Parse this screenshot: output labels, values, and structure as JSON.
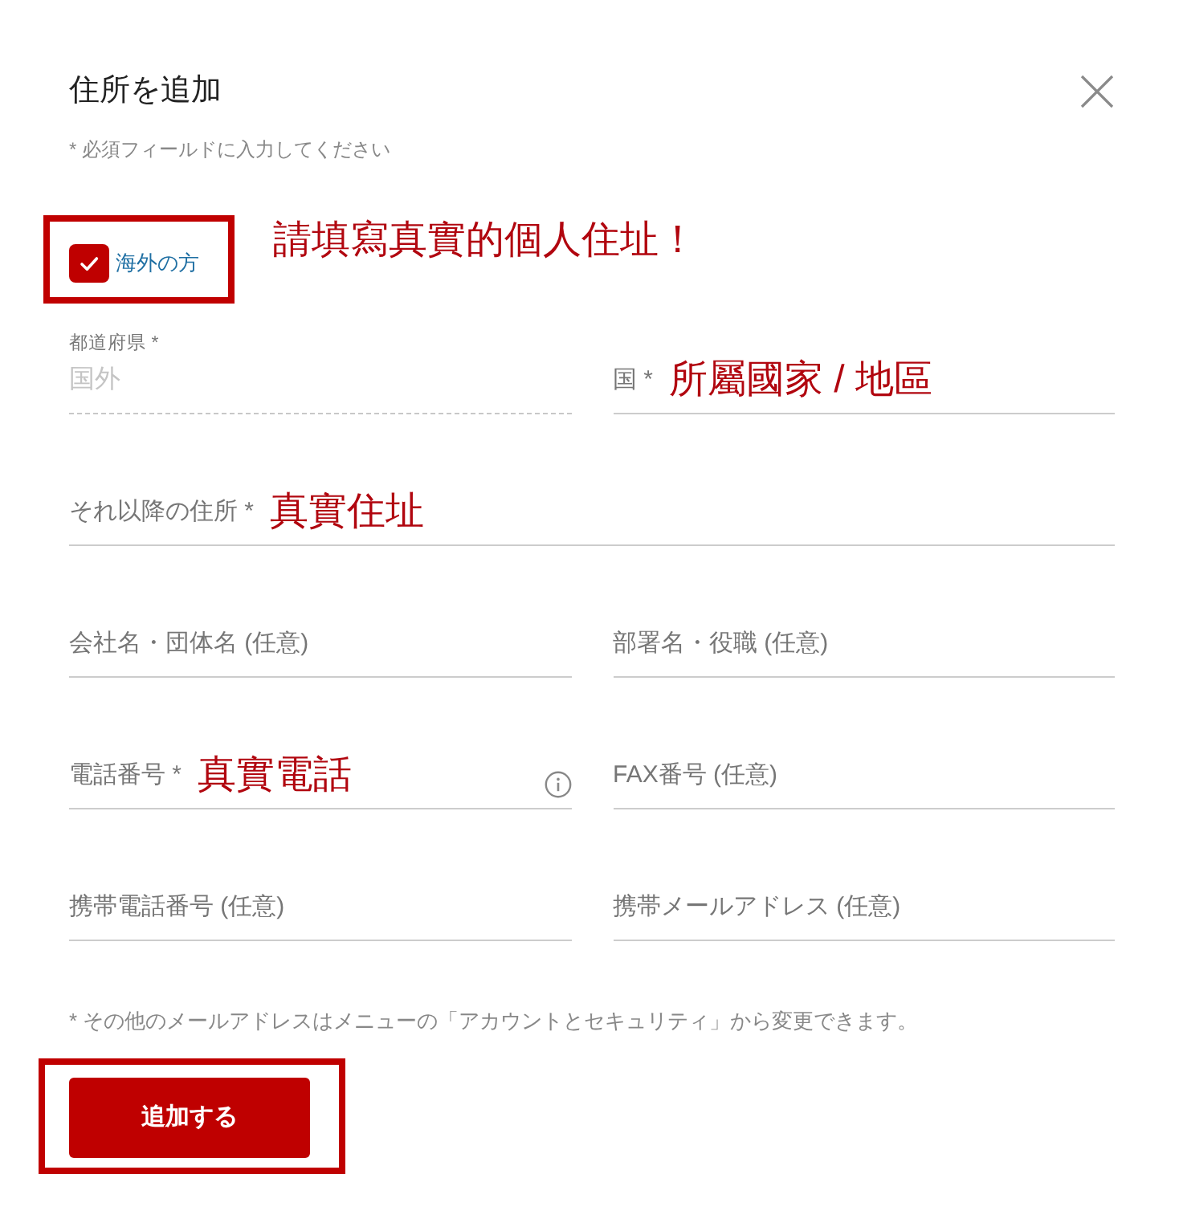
{
  "dialog": {
    "title": "住所を追加",
    "required_note": "* 必須フィールドに入力してください"
  },
  "overseas": {
    "label": "海外の方",
    "checked": true,
    "highlighted": true,
    "annotation": "請填寫真實的個人住址！"
  },
  "rows": [
    {
      "fields": [
        {
          "floating_label": "都道府県 *",
          "value": "国外",
          "disabled": true
        },
        {
          "label": "国 *",
          "annotation": "所屬國家 / 地區"
        }
      ]
    },
    {
      "fields": [
        {
          "label": "それ以降の住所 *",
          "annotation": "真實住址"
        }
      ]
    },
    {
      "fields": [
        {
          "label": "会社名・団体名 (任意)"
        },
        {
          "label": "部署名・役職 (任意)"
        }
      ]
    },
    {
      "fields": [
        {
          "label": "電話番号 *",
          "annotation": "真實電話",
          "info": true
        },
        {
          "label": "FAX番号 (任意)"
        }
      ]
    },
    {
      "fields": [
        {
          "label": "携帯電話番号 (任意)"
        },
        {
          "label": "携帯メールアドレス (任意)"
        }
      ]
    }
  ],
  "footnote": "* その他のメールアドレスはメニューの「アカウントとセキュリティ」から変更できます。",
  "submit": {
    "label": "追加する",
    "highlighted": true
  }
}
